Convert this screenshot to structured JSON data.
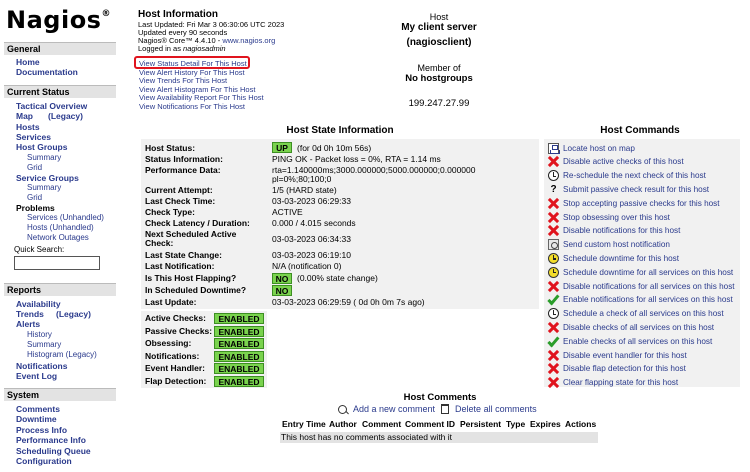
{
  "brand": {
    "name": "Nagios",
    "reg": "®"
  },
  "sidebar": {
    "general": {
      "title": "General",
      "items": [
        "Home",
        "Documentation"
      ]
    },
    "current_status": {
      "title": "Current Status",
      "tactical": "Tactical Overview",
      "map": "Map",
      "legacy": "(Legacy)",
      "hosts": "Hosts",
      "services": "Services",
      "host_groups": "Host Groups",
      "hg_summary": "Summary",
      "hg_grid": "Grid",
      "service_groups": "Service Groups",
      "sg_summary": "Summary",
      "sg_grid": "Grid",
      "problems": "Problems",
      "pr_services": "Services (Unhandled)",
      "pr_hosts": "Hosts (Unhandled)",
      "pr_network": "Network Outages",
      "quick_search": "Quick Search:"
    },
    "reports": {
      "title": "Reports",
      "availability": "Availability",
      "trends": "Trends",
      "trends_legacy": "(Legacy)",
      "alerts": "Alerts",
      "history": "History",
      "summary": "Summary",
      "histogram": "Histogram (Legacy)",
      "notifications": "Notifications",
      "event_log": "Event Log"
    },
    "system": {
      "title": "System",
      "items": [
        "Comments",
        "Downtime",
        "Process Info",
        "Performance Info",
        "Scheduling Queue",
        "Configuration"
      ]
    }
  },
  "host_info": {
    "title": "Host Information",
    "updated": "Last Updated: Fri Mar 3 06:30:06 UTC 2023",
    "every": "Updated every 90 seconds",
    "version_prefix": "Nagios® Core™ 4.4.10 - ",
    "version_link": "www.nagios.org",
    "logged_prefix": "Logged in as ",
    "logged_user": "nagiosadmin",
    "links": [
      "View Status Detail For This Host",
      "View Alert History For This Host",
      "View Trends For This Host",
      "View Alert Histogram For This Host",
      "View Availability Report For This Host",
      "View Notifications For This Host"
    ]
  },
  "host": {
    "label": "Host",
    "name": "My client server",
    "alias": "(nagiosclient)",
    "member_of": "Member of",
    "groups": "No hostgroups",
    "address": "199.247.27.99"
  },
  "state_info": {
    "title": "Host State Information",
    "rows": [
      {
        "label": "Host Status:",
        "value": "(for 0d 0h 10m 56s)",
        "badge": "UP"
      },
      {
        "label": "Status Information:",
        "value": "PING OK - Packet loss = 0%, RTA = 1.14 ms"
      },
      {
        "label": "Performance Data:",
        "value": "rta=1.140000ms;3000.000000;5000.000000;0.000000"
      },
      {
        "label": "",
        "value": "pl=0%;80;100;0"
      },
      {
        "label": "Current Attempt:",
        "value": "1/5  (HARD state)"
      },
      {
        "label": "Last Check Time:",
        "value": "03-03-2023 06:29:33"
      },
      {
        "label": "Check Type:",
        "value": "ACTIVE"
      },
      {
        "label": "Check Latency / Duration:",
        "value": "0.000 / 4.015 seconds"
      },
      {
        "label": "Next Scheduled Active",
        "value": "03-03-2023 06:34:33"
      },
      {
        "label": "Check:",
        "value": ""
      },
      {
        "label": "Last State Change:",
        "value": "03-03-2023 06:19:10"
      },
      {
        "label": "Last Notification:",
        "value": "N/A (notification 0)"
      },
      {
        "label": "Is This Host Flapping?",
        "value": "(0.00% state change)",
        "badge": "NO"
      },
      {
        "label": "In Scheduled Downtime?",
        "value": "",
        "badge": "NO"
      },
      {
        "label": "Last Update:",
        "value": "03-03-2023 06:29:59  ( 0d 0h 0m 7s ago)"
      }
    ],
    "checks": [
      {
        "label": "Active Checks:",
        "state": "ENABLED"
      },
      {
        "label": "Passive Checks:",
        "state": "ENABLED"
      },
      {
        "label": "Obsessing:",
        "state": "ENABLED"
      },
      {
        "label": "Notifications:",
        "state": "ENABLED"
      },
      {
        "label": "Event Handler:",
        "state": "ENABLED"
      },
      {
        "label": "Flap Detection:",
        "state": "ENABLED"
      }
    ]
  },
  "commands": {
    "title": "Host Commands",
    "items": [
      {
        "icon": "map-icon",
        "label": "Locate host on map"
      },
      {
        "icon": "disable-icon",
        "label": "Disable active checks of this host"
      },
      {
        "icon": "clock-icon",
        "label": "Re-schedule the next check of this host"
      },
      {
        "icon": "question-icon",
        "label": "Submit passive check result for this host"
      },
      {
        "icon": "disable-icon",
        "label": "Stop accepting passive checks for this host"
      },
      {
        "icon": "disable-icon",
        "label": "Stop obsessing over this host"
      },
      {
        "icon": "disable-icon",
        "label": "Disable notifications for this host"
      },
      {
        "icon": "notify-icon",
        "label": "Send custom host notification"
      },
      {
        "icon": "downtime-icon",
        "label": "Schedule downtime for this host"
      },
      {
        "icon": "downtime-icon",
        "label": "Schedule downtime for all services on this host"
      },
      {
        "icon": "disable-icon",
        "label": "Disable notifications for all services on this host"
      },
      {
        "icon": "enable-icon",
        "label": "Enable notifications for all services on this host"
      },
      {
        "icon": "clock-icon",
        "label": "Schedule a check of all services on this host"
      },
      {
        "icon": "disable-icon",
        "label": "Disable checks of all services on this host"
      },
      {
        "icon": "enable-icon",
        "label": "Enable checks of all services on this host"
      },
      {
        "icon": "disable-icon",
        "label": "Disable event handler for this host"
      },
      {
        "icon": "disable-icon",
        "label": "Disable flap detection for this host"
      },
      {
        "icon": "disable-icon",
        "label": "Clear flapping state for this host"
      }
    ]
  },
  "comments": {
    "title": "Host Comments",
    "add": "Add a new comment",
    "delete": "Delete all comments",
    "columns": [
      "Entry Time",
      "Author",
      "Comment",
      "Comment ID",
      "Persistent",
      "Type",
      "Expires",
      "Actions"
    ],
    "empty": "This host has no comments associated with it"
  },
  "colors": {
    "link": "#2a3a8c",
    "enabled": "#7ad34e",
    "highlight": "#e0141e"
  }
}
